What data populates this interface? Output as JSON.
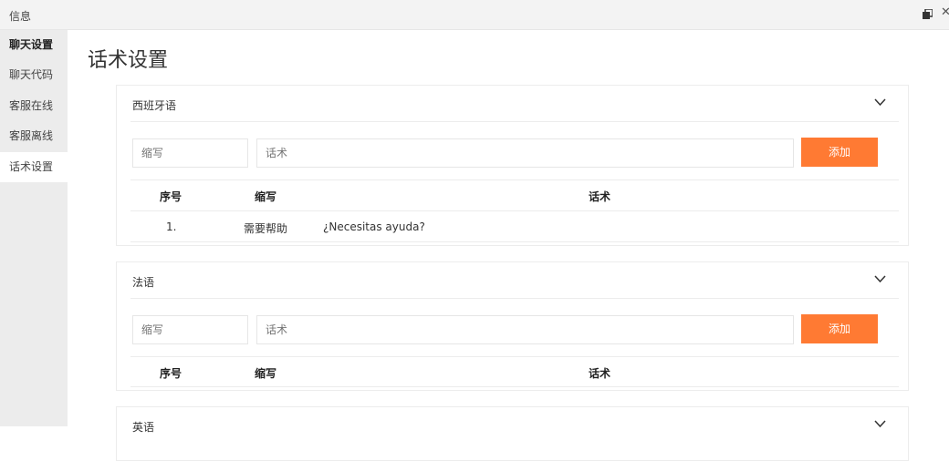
{
  "window": {
    "title": "信息"
  },
  "sidebar": {
    "items": [
      {
        "label": "聊天设置"
      },
      {
        "label": "聊天代码"
      },
      {
        "label": "客服在线"
      },
      {
        "label": "客服离线"
      },
      {
        "label": "话术设置"
      }
    ]
  },
  "page": {
    "title": "话术设置"
  },
  "form": {
    "abbr_placeholder": "缩写",
    "phrase_placeholder": "话术",
    "add_label": "添加"
  },
  "table": {
    "columns": [
      "序号",
      "缩写",
      "话术"
    ]
  },
  "sections": [
    {
      "name": "西班牙语",
      "rows": [
        {
          "index": "1.",
          "abbr": "需要帮助",
          "phrase": "¿Necesitas ayuda?"
        }
      ]
    },
    {
      "name": "法语",
      "rows": []
    },
    {
      "name": "英语",
      "rows": []
    }
  ],
  "colors": {
    "accent": "#ff7a33",
    "sidebar_bg": "#ececec"
  }
}
